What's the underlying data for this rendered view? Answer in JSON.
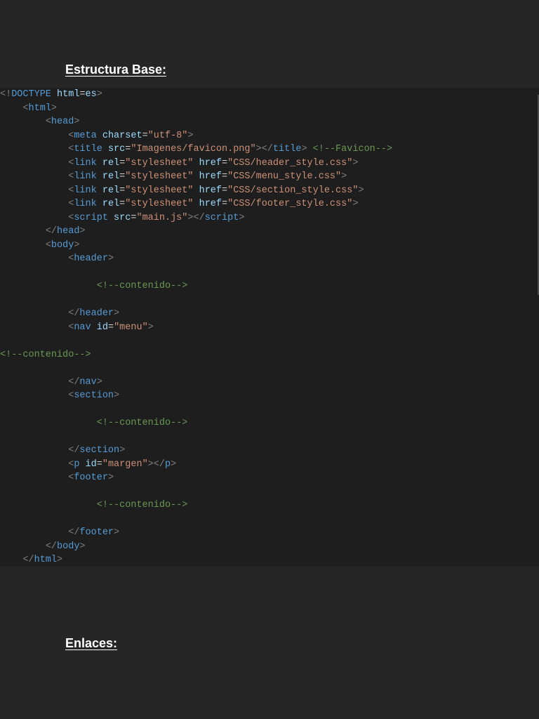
{
  "headings": {
    "estructura": "Estructura Base:",
    "enlaces": "Enlaces:"
  },
  "code_lines": [
    {
      "indent": 0,
      "tokens": [
        [
          "p",
          "<!"
        ],
        [
          "t",
          "DOCTYPE"
        ],
        [
          "x",
          " "
        ],
        [
          "a",
          "html"
        ],
        [
          "x",
          "="
        ],
        [
          "a",
          "es"
        ],
        [
          "p",
          ">"
        ]
      ]
    },
    {
      "indent": 4,
      "tokens": [
        [
          "p",
          "<"
        ],
        [
          "t",
          "html"
        ],
        [
          "p",
          ">"
        ]
      ]
    },
    {
      "indent": 8,
      "tokens": [
        [
          "p",
          "<"
        ],
        [
          "t",
          "head"
        ],
        [
          "p",
          ">"
        ]
      ]
    },
    {
      "indent": 12,
      "tokens": [
        [
          "p",
          "<"
        ],
        [
          "t",
          "meta"
        ],
        [
          "x",
          " "
        ],
        [
          "a",
          "charset"
        ],
        [
          "x",
          "="
        ],
        [
          "s",
          "\"utf-8\""
        ],
        [
          "p",
          ">"
        ]
      ]
    },
    {
      "indent": 12,
      "tokens": [
        [
          "p",
          "<"
        ],
        [
          "t",
          "title"
        ],
        [
          "x",
          " "
        ],
        [
          "a",
          "src"
        ],
        [
          "x",
          "="
        ],
        [
          "s",
          "\"Imagenes/favicon.png\""
        ],
        [
          "p",
          "></"
        ],
        [
          "t",
          "title"
        ],
        [
          "p",
          ">"
        ],
        [
          "x",
          " "
        ],
        [
          "c",
          "<!--Favicon-->"
        ]
      ]
    },
    {
      "indent": 12,
      "tokens": [
        [
          "p",
          "<"
        ],
        [
          "t",
          "link"
        ],
        [
          "x",
          " "
        ],
        [
          "a",
          "rel"
        ],
        [
          "x",
          "="
        ],
        [
          "s",
          "\"stylesheet\""
        ],
        [
          "x",
          " "
        ],
        [
          "a",
          "href"
        ],
        [
          "x",
          "="
        ],
        [
          "s",
          "\"CSS/header_style.css\""
        ],
        [
          "p",
          ">"
        ]
      ]
    },
    {
      "indent": 12,
      "tokens": [
        [
          "p",
          "<"
        ],
        [
          "t",
          "link"
        ],
        [
          "x",
          " "
        ],
        [
          "a",
          "rel"
        ],
        [
          "x",
          "="
        ],
        [
          "s",
          "\"stylesheet\""
        ],
        [
          "x",
          " "
        ],
        [
          "a",
          "href"
        ],
        [
          "x",
          "="
        ],
        [
          "s",
          "\"CSS/menu_style.css\""
        ],
        [
          "p",
          ">"
        ]
      ]
    },
    {
      "indent": 12,
      "tokens": [
        [
          "p",
          "<"
        ],
        [
          "t",
          "link"
        ],
        [
          "x",
          " "
        ],
        [
          "a",
          "rel"
        ],
        [
          "x",
          "="
        ],
        [
          "s",
          "\"stylesheet\""
        ],
        [
          "x",
          " "
        ],
        [
          "a",
          "href"
        ],
        [
          "x",
          "="
        ],
        [
          "s",
          "\"CSS/section_style.css\""
        ],
        [
          "p",
          ">"
        ]
      ]
    },
    {
      "indent": 12,
      "tokens": [
        [
          "p",
          "<"
        ],
        [
          "t",
          "link"
        ],
        [
          "x",
          " "
        ],
        [
          "a",
          "rel"
        ],
        [
          "x",
          "="
        ],
        [
          "s",
          "\"stylesheet\""
        ],
        [
          "x",
          " "
        ],
        [
          "a",
          "href"
        ],
        [
          "x",
          "="
        ],
        [
          "s",
          "\"CSS/footer_style.css\""
        ],
        [
          "p",
          ">"
        ]
      ]
    },
    {
      "indent": 12,
      "tokens": [
        [
          "p",
          "<"
        ],
        [
          "t",
          "script"
        ],
        [
          "x",
          " "
        ],
        [
          "a",
          "src"
        ],
        [
          "x",
          "="
        ],
        [
          "s",
          "\"main.js\""
        ],
        [
          "p",
          "></"
        ],
        [
          "t",
          "script"
        ],
        [
          "p",
          ">"
        ]
      ]
    },
    {
      "indent": 8,
      "tokens": [
        [
          "p",
          "</"
        ],
        [
          "t",
          "head"
        ],
        [
          "p",
          ">"
        ]
      ]
    },
    {
      "indent": 8,
      "tokens": [
        [
          "p",
          "<"
        ],
        [
          "t",
          "body"
        ],
        [
          "p",
          ">"
        ]
      ]
    },
    {
      "indent": 12,
      "tokens": [
        [
          "p",
          "<"
        ],
        [
          "t",
          "header"
        ],
        [
          "p",
          ">"
        ]
      ]
    },
    {
      "indent": 0,
      "tokens": []
    },
    {
      "indent": 17,
      "tokens": [
        [
          "c",
          "<!--contenido-->"
        ]
      ]
    },
    {
      "indent": 0,
      "tokens": []
    },
    {
      "indent": 12,
      "tokens": [
        [
          "p",
          "</"
        ],
        [
          "t",
          "header"
        ],
        [
          "p",
          ">"
        ]
      ]
    },
    {
      "indent": 12,
      "tokens": [
        [
          "p",
          "<"
        ],
        [
          "t",
          "nav"
        ],
        [
          "x",
          " "
        ],
        [
          "a",
          "id"
        ],
        [
          "x",
          "="
        ],
        [
          "s",
          "\"menu\""
        ],
        [
          "p",
          ">"
        ]
      ]
    },
    {
      "indent": 0,
      "tokens": []
    },
    {
      "indent": 0,
      "tokens": [
        [
          "c",
          "<!--contenido-->"
        ]
      ]
    },
    {
      "indent": 0,
      "tokens": []
    },
    {
      "indent": 12,
      "tokens": [
        [
          "p",
          "</"
        ],
        [
          "t",
          "nav"
        ],
        [
          "p",
          ">"
        ]
      ]
    },
    {
      "indent": 12,
      "tokens": [
        [
          "p",
          "<"
        ],
        [
          "t",
          "section"
        ],
        [
          "p",
          ">"
        ]
      ]
    },
    {
      "indent": 0,
      "tokens": []
    },
    {
      "indent": 17,
      "tokens": [
        [
          "c",
          "<!--contenido-->"
        ]
      ]
    },
    {
      "indent": 0,
      "tokens": []
    },
    {
      "indent": 12,
      "tokens": [
        [
          "p",
          "</"
        ],
        [
          "t",
          "section"
        ],
        [
          "p",
          ">"
        ]
      ]
    },
    {
      "indent": 12,
      "tokens": [
        [
          "p",
          "<"
        ],
        [
          "t",
          "p"
        ],
        [
          "x",
          " "
        ],
        [
          "a",
          "id"
        ],
        [
          "x",
          "="
        ],
        [
          "s",
          "\"margen\""
        ],
        [
          "p",
          "></"
        ],
        [
          "t",
          "p"
        ],
        [
          "p",
          ">"
        ]
      ]
    },
    {
      "indent": 12,
      "tokens": [
        [
          "p",
          "<"
        ],
        [
          "t",
          "footer"
        ],
        [
          "p",
          ">"
        ]
      ]
    },
    {
      "indent": 0,
      "tokens": []
    },
    {
      "indent": 17,
      "tokens": [
        [
          "c",
          "<!--contenido-->"
        ]
      ]
    },
    {
      "indent": 0,
      "tokens": []
    },
    {
      "indent": 12,
      "tokens": [
        [
          "p",
          "</"
        ],
        [
          "t",
          "footer"
        ],
        [
          "p",
          ">"
        ]
      ]
    },
    {
      "indent": 8,
      "tokens": [
        [
          "p",
          "</"
        ],
        [
          "t",
          "body"
        ],
        [
          "p",
          ">"
        ]
      ]
    },
    {
      "indent": 4,
      "tokens": [
        [
          "p",
          "</"
        ],
        [
          "t",
          "html"
        ],
        [
          "p",
          ">"
        ]
      ]
    }
  ]
}
